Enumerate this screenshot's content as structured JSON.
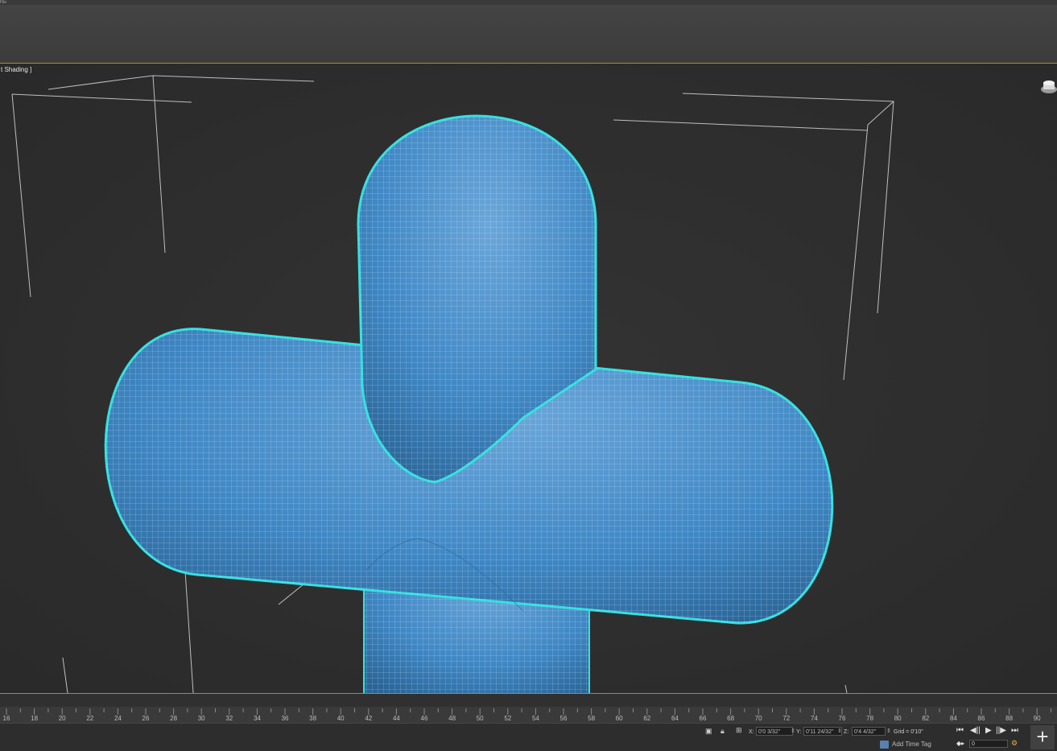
{
  "menubar": {
    "stub": "File"
  },
  "viewport": {
    "label": "[ Default Shading ]",
    "label_visible": "t Shading ]",
    "object_color": "#3f88c5",
    "selection_color": "#35e0e0"
  },
  "timeline": {
    "tick_labels": [
      "16",
      "18",
      "20",
      "22",
      "24",
      "26",
      "28",
      "30",
      "32",
      "34",
      "36",
      "38",
      "40",
      "42",
      "44",
      "46",
      "48",
      "50",
      "52",
      "54",
      "56",
      "58",
      "60",
      "62",
      "64",
      "66",
      "68",
      "70",
      "72",
      "74",
      "76",
      "78",
      "80",
      "82",
      "84",
      "86",
      "88",
      "90"
    ]
  },
  "status": {
    "x_label": "X:",
    "x_value": "0'0 3/32\"",
    "y_label": "Y:",
    "y_value": "0'11 24/32\"",
    "z_label": "Z:",
    "z_value": "0'4 4/32\"",
    "grid": "Grid = 0'10\"",
    "add_time_tag": "Add Time Tag",
    "frame_value": "0"
  },
  "icons": [
    "selection-lock-icon",
    "lock-icon",
    "absolute-mode-icon",
    "go-to-start-icon",
    "previous-frame-icon",
    "play-icon",
    "next-frame-icon",
    "go-to-end-icon",
    "key-mode-icon",
    "time-config-icon",
    "create-plus-icon",
    "viewcube-icon"
  ]
}
